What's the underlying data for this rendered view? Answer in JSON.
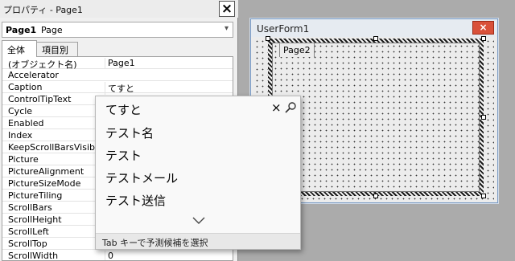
{
  "properties_window": {
    "title": "プロパティ - Page1",
    "close_glyph": "×",
    "object_selector": {
      "name": "Page1",
      "type": "Page",
      "dropdown_glyph": "▾"
    },
    "tabs": [
      {
        "label": "全体"
      },
      {
        "label": "項目別"
      }
    ],
    "rows": [
      {
        "name": "(オブジェクト名)",
        "value": "Page1"
      },
      {
        "name": "Accelerator",
        "value": ""
      },
      {
        "name": "Caption",
        "value": "てすと"
      },
      {
        "name": "ControlTipText",
        "value": ""
      },
      {
        "name": "Cycle",
        "value": ""
      },
      {
        "name": "Enabled",
        "value": ""
      },
      {
        "name": "Index",
        "value": ""
      },
      {
        "name": "KeepScrollBarsVisib",
        "value": ""
      },
      {
        "name": "Picture",
        "value": ""
      },
      {
        "name": "PictureAlignment",
        "value": ""
      },
      {
        "name": "PictureSizeMode",
        "value": ""
      },
      {
        "name": "PictureTiling",
        "value": ""
      },
      {
        "name": "ScrollBars",
        "value": ""
      },
      {
        "name": "ScrollHeight",
        "value": ""
      },
      {
        "name": "ScrollLeft",
        "value": ""
      },
      {
        "name": "ScrollTop",
        "value": ""
      },
      {
        "name": "ScrollWidth",
        "value": "0"
      }
    ]
  },
  "ime_popup": {
    "candidates": [
      "てすと",
      "テスト名",
      "テスト",
      "テストメール",
      "テスト送信"
    ],
    "close_glyph": "×",
    "footer_hint": "Tab キーで予測候補を選択"
  },
  "userform": {
    "title": "UserForm1",
    "close_glyph": "×",
    "multipage_tab": "Page2"
  },
  "colors": {
    "desktop": "#ababab",
    "close_red": "#d9513a",
    "title_blue_border": "#7a9bc4"
  }
}
